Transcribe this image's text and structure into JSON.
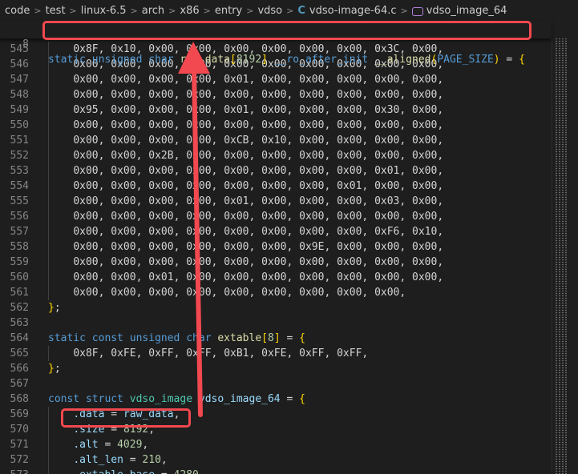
{
  "breadcrumb": {
    "items": [
      "code",
      "test",
      "linux-6.5",
      "arch",
      "x86",
      "entry",
      "vdso"
    ],
    "file_name": "vdso-image-64.c",
    "file_icon": "C",
    "symbol": "vdso_image_64",
    "separator": ">"
  },
  "colors": {
    "annotation": "#f2484f",
    "keyword": "#569cd6",
    "type": "#4ec9b0",
    "function": "#dcdcaa",
    "variable": "#9cdcfe",
    "number": "#b5cea8",
    "bracket_outer": "#ffd700",
    "bracket_inner": "#da70d6"
  },
  "sticky_line": {
    "number": "8",
    "tokens": [
      {
        "t": "static",
        "c": "kw"
      },
      {
        "t": " "
      },
      {
        "t": "unsigned",
        "c": "kw"
      },
      {
        "t": " "
      },
      {
        "t": "char",
        "c": "kw"
      },
      {
        "t": " "
      },
      {
        "t": "raw_data",
        "c": "fn"
      },
      {
        "t": "[",
        "c": "br1"
      },
      {
        "t": "8192",
        "c": "nm"
      },
      {
        "t": "]",
        "c": "br1"
      },
      {
        "t": " "
      },
      {
        "t": "__ro_after_init",
        "c": "mc"
      },
      {
        "t": " "
      },
      {
        "t": "__aligned",
        "c": "fn"
      },
      {
        "t": "(",
        "c": "br1"
      },
      {
        "t": "PAGE_SIZE",
        "c": "mc"
      },
      {
        "t": ")",
        "c": "br1"
      },
      {
        "t": " = "
      },
      {
        "t": "{",
        "c": "br1"
      }
    ]
  },
  "lines": [
    {
      "n": "545",
      "hex": [
        "0x8F",
        "0x10",
        "0x00",
        "0x00",
        "0x00",
        "0x00",
        "0x00",
        "0x00",
        "0x3C",
        "0x00"
      ]
    },
    {
      "n": "546",
      "hex": [
        "0x00",
        "0x00",
        "0x00",
        "0x00",
        "0x00",
        "0x00",
        "0x00",
        "0x00",
        "0x00",
        "0x00"
      ]
    },
    {
      "n": "547",
      "hex": [
        "0x00",
        "0x00",
        "0x00",
        "0x00",
        "0x01",
        "0x00",
        "0x00",
        "0x00",
        "0x00",
        "0x00"
      ]
    },
    {
      "n": "548",
      "hex": [
        "0x00",
        "0x00",
        "0x00",
        "0x00",
        "0x00",
        "0x00",
        "0x00",
        "0x00",
        "0x00",
        "0x00"
      ]
    },
    {
      "n": "549",
      "hex": [
        "0x95",
        "0x00",
        "0x00",
        "0x00",
        "0x01",
        "0x00",
        "0x00",
        "0x00",
        "0x30",
        "0x00"
      ]
    },
    {
      "n": "550",
      "hex": [
        "0x00",
        "0x00",
        "0x00",
        "0x00",
        "0x00",
        "0x00",
        "0x00",
        "0x00",
        "0x00",
        "0x00"
      ]
    },
    {
      "n": "551",
      "hex": [
        "0x00",
        "0x00",
        "0x00",
        "0x00",
        "0xCB",
        "0x10",
        "0x00",
        "0x00",
        "0x00",
        "0x00"
      ]
    },
    {
      "n": "552",
      "hex": [
        "0x00",
        "0x00",
        "0x2B",
        "0x00",
        "0x00",
        "0x00",
        "0x00",
        "0x00",
        "0x00",
        "0x00"
      ]
    },
    {
      "n": "553",
      "hex": [
        "0x00",
        "0x00",
        "0x00",
        "0x00",
        "0x00",
        "0x00",
        "0x00",
        "0x00",
        "0x01",
        "0x00"
      ]
    },
    {
      "n": "554",
      "hex": [
        "0x00",
        "0x00",
        "0x00",
        "0x00",
        "0x00",
        "0x00",
        "0x00",
        "0x01",
        "0x00",
        "0x00"
      ]
    },
    {
      "n": "555",
      "hex": [
        "0x00",
        "0x00",
        "0x00",
        "0x00",
        "0x01",
        "0x00",
        "0x00",
        "0x00",
        "0x03",
        "0x00"
      ]
    },
    {
      "n": "556",
      "hex": [
        "0x00",
        "0x00",
        "0x00",
        "0x00",
        "0x00",
        "0x00",
        "0x00",
        "0x00",
        "0x00",
        "0x00"
      ]
    },
    {
      "n": "557",
      "hex": [
        "0x00",
        "0x00",
        "0x00",
        "0x00",
        "0x00",
        "0x00",
        "0x00",
        "0x00",
        "0xF6",
        "0x10"
      ]
    },
    {
      "n": "558",
      "hex": [
        "0x00",
        "0x00",
        "0x00",
        "0x00",
        "0x00",
        "0x00",
        "0x9E",
        "0x00",
        "0x00",
        "0x00"
      ]
    },
    {
      "n": "559",
      "hex": [
        "0x00",
        "0x00",
        "0x00",
        "0x00",
        "0x00",
        "0x00",
        "0x00",
        "0x00",
        "0x00",
        "0x00"
      ]
    },
    {
      "n": "560",
      "hex": [
        "0x00",
        "0x00",
        "0x01",
        "0x00",
        "0x00",
        "0x00",
        "0x00",
        "0x00",
        "0x00",
        "0x00"
      ]
    },
    {
      "n": "561",
      "hex": [
        "0x00",
        "0x00",
        "0x00",
        "0x00",
        "0x00",
        "0x00",
        "0x00",
        "0x00",
        "0x00"
      ]
    },
    {
      "n": "562",
      "tokens": [
        {
          "t": "}",
          "c": "br1"
        },
        {
          "t": ";"
        }
      ]
    },
    {
      "n": "563",
      "tokens": []
    },
    {
      "n": "564",
      "tokens": [
        {
          "t": "static",
          "c": "kw"
        },
        {
          "t": " "
        },
        {
          "t": "const",
          "c": "kw"
        },
        {
          "t": " "
        },
        {
          "t": "unsigned",
          "c": "kw"
        },
        {
          "t": " "
        },
        {
          "t": "char",
          "c": "kw"
        },
        {
          "t": " "
        },
        {
          "t": "extable",
          "c": "fn"
        },
        {
          "t": "[",
          "c": "br1"
        },
        {
          "t": "8",
          "c": "nm"
        },
        {
          "t": "]",
          "c": "br1"
        },
        {
          "t": " = "
        },
        {
          "t": "{",
          "c": "br1"
        }
      ]
    },
    {
      "n": "565",
      "hex": [
        "0x8F",
        "0xFE",
        "0xFF",
        "0xFF",
        "0xB1",
        "0xFE",
        "0xFF",
        "0xFF"
      ]
    },
    {
      "n": "566",
      "tokens": [
        {
          "t": "}",
          "c": "br1"
        },
        {
          "t": ";"
        }
      ]
    },
    {
      "n": "567",
      "tokens": []
    },
    {
      "n": "568",
      "tokens": [
        {
          "t": "const",
          "c": "kw"
        },
        {
          "t": " "
        },
        {
          "t": "struct",
          "c": "kw"
        },
        {
          "t": " "
        },
        {
          "t": "vdso_image",
          "c": "ty"
        },
        {
          "t": " "
        },
        {
          "t": "vdso_image_64",
          "c": "vr"
        },
        {
          "t": " = "
        },
        {
          "t": "{",
          "c": "br1"
        }
      ]
    },
    {
      "n": "569",
      "field": ".data",
      "value": "raw_data",
      "value_class": "vr"
    },
    {
      "n": "570",
      "field": ".size",
      "value": "8192",
      "value_class": "nm"
    },
    {
      "n": "571",
      "field": ".alt",
      "value": "4029",
      "value_class": "nm"
    },
    {
      "n": "572",
      "field": ".alt_len",
      "value": "210",
      "value_class": "nm"
    },
    {
      "n": "573",
      "field": ".extable_base",
      "value": "4280",
      "value_class": "nm"
    }
  ]
}
